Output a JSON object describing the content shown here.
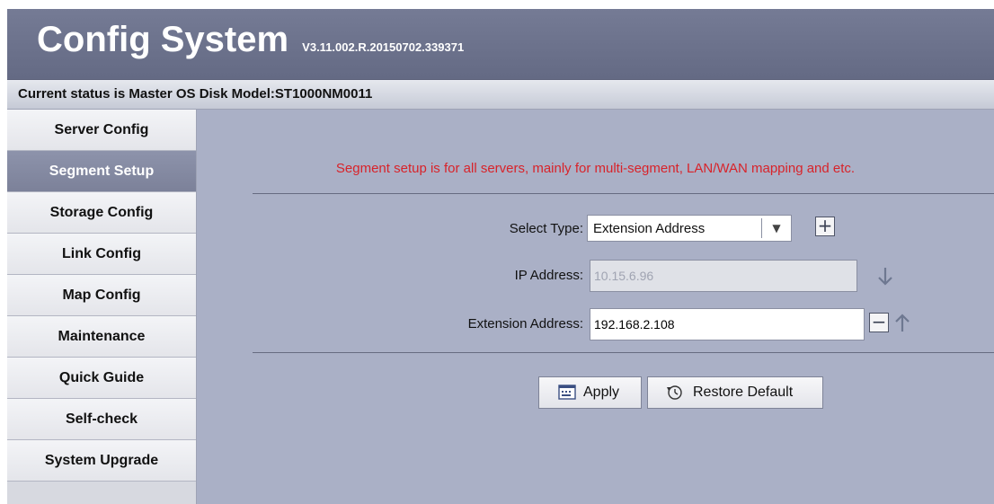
{
  "app": {
    "title": "Config System",
    "version": "V3.11.002.R.20150702.339371"
  },
  "status": {
    "text": "Current status is  Master OS Disk Model:ST1000NM0011"
  },
  "sidebar": {
    "items": [
      {
        "label": "Server Config",
        "active": false
      },
      {
        "label": "Segment Setup",
        "active": true
      },
      {
        "label": "Storage Config",
        "active": false
      },
      {
        "label": "Link Config",
        "active": false
      },
      {
        "label": "Map Config",
        "active": false
      },
      {
        "label": "Maintenance",
        "active": false
      },
      {
        "label": "Quick Guide",
        "active": false
      },
      {
        "label": "Self-check",
        "active": false
      },
      {
        "label": "System Upgrade",
        "active": false
      }
    ]
  },
  "main": {
    "notice": "Segment setup is for all servers, mainly for multi-segment, LAN/WAN mapping and etc.",
    "select_type": {
      "label": "Select Type:",
      "value": "Extension Address"
    },
    "ip_address": {
      "label": "IP Address:",
      "value": "10.15.6.96"
    },
    "extension_address": {
      "label": "Extension Address:",
      "value": "192.168.2.108"
    },
    "apply_label": "Apply",
    "restore_label": "Restore Default"
  },
  "icons": {
    "add": "plus-icon",
    "remove": "minus-icon",
    "move_down": "arrow-down-icon",
    "move_up": "arrow-up-icon",
    "apply": "keyboard-icon",
    "restore": "restore-clock-icon",
    "dropdown": "chevron-down-icon"
  },
  "colors": {
    "header": "#6b718b",
    "background": "#aab0c6",
    "active_item": "#8389a2",
    "notice": "#d8232a",
    "arrow": "#6e7891"
  }
}
